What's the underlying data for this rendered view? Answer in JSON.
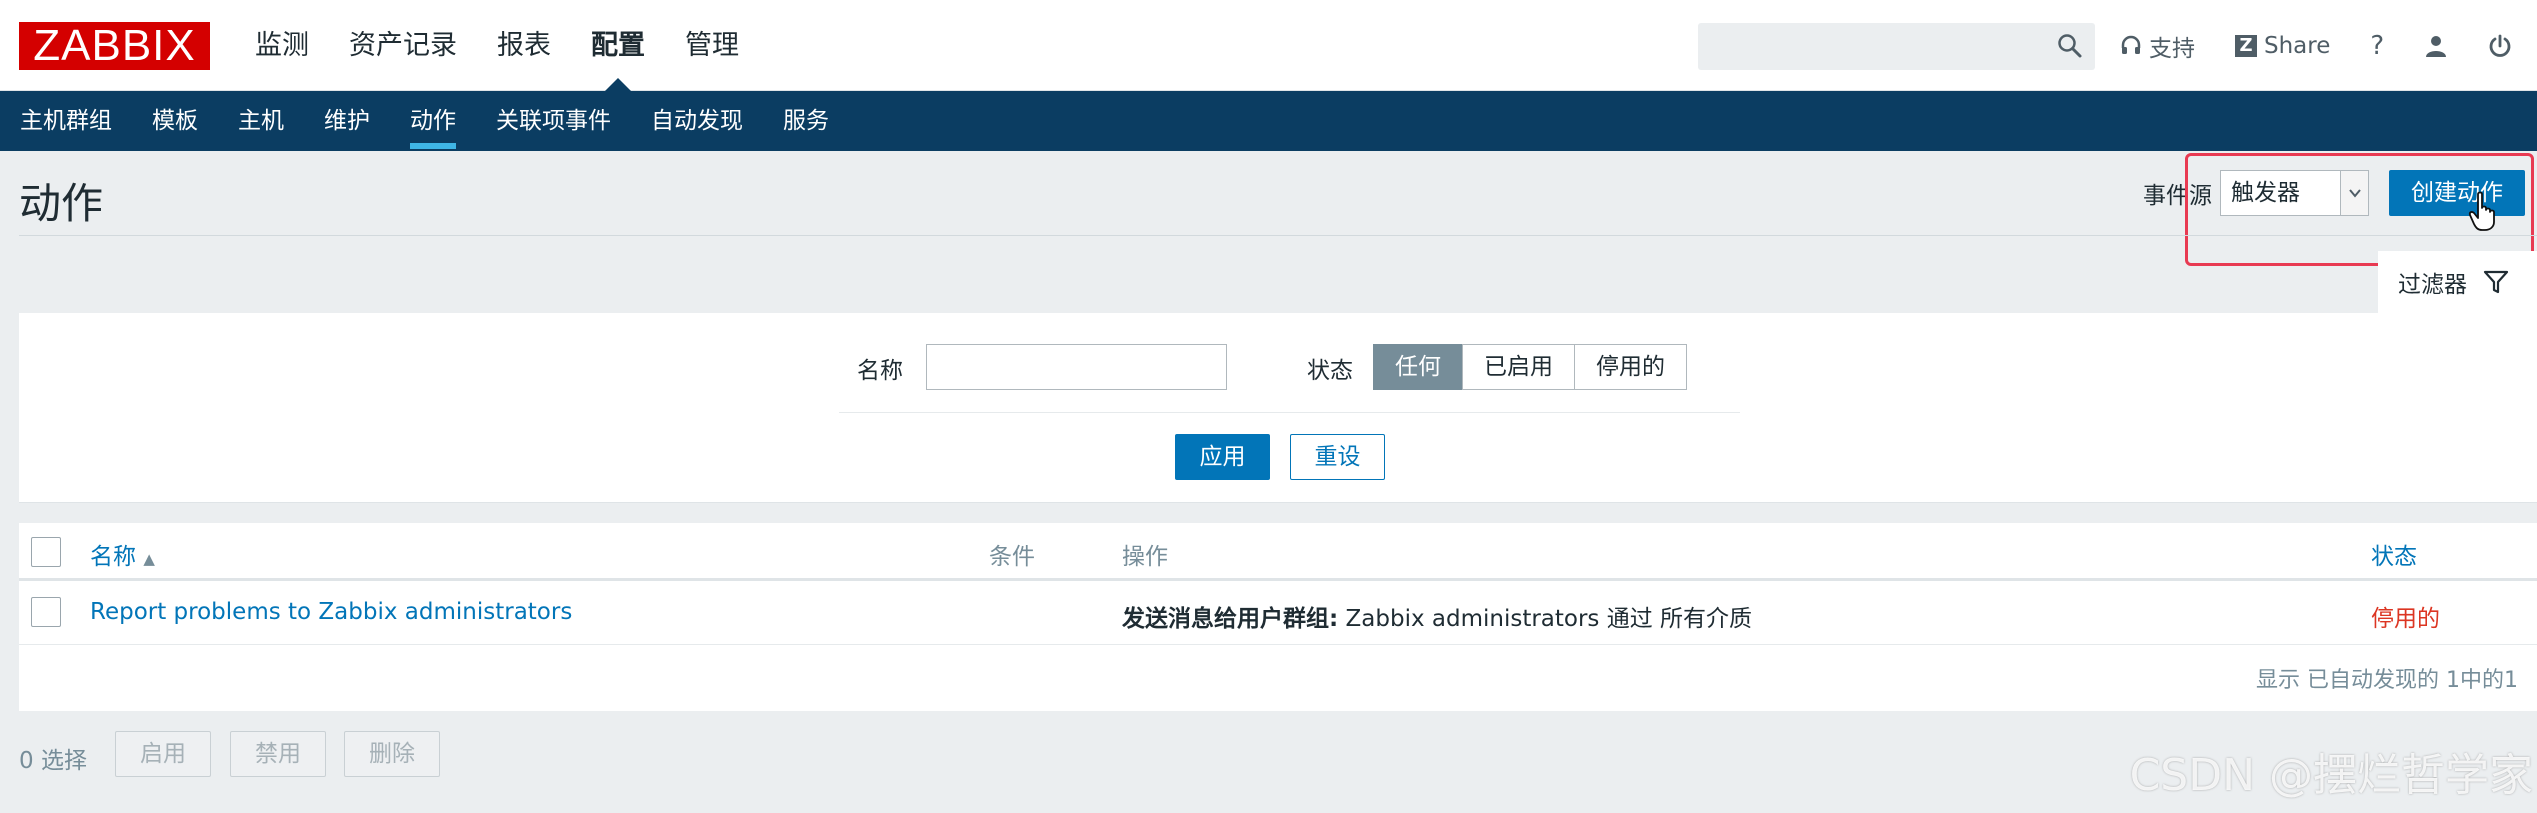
{
  "brand": {
    "logo_text": "ZABBIX",
    "logo_color": "#d40000"
  },
  "main_menu": [
    {
      "label": "监测",
      "active": false
    },
    {
      "label": "资产记录",
      "active": false
    },
    {
      "label": "报表",
      "active": false
    },
    {
      "label": "配置",
      "active": true
    },
    {
      "label": "管理",
      "active": false
    }
  ],
  "search": {
    "placeholder": "",
    "value": ""
  },
  "top_links": {
    "support": "支持",
    "share": "Share",
    "help": "?"
  },
  "sub_menu": [
    {
      "label": "主机群组",
      "active": false
    },
    {
      "label": "模板",
      "active": false
    },
    {
      "label": "主机",
      "active": false
    },
    {
      "label": "维护",
      "active": false
    },
    {
      "label": "动作",
      "active": true
    },
    {
      "label": "关联项事件",
      "active": false
    },
    {
      "label": "自动发现",
      "active": false
    },
    {
      "label": "服务",
      "active": false
    }
  ],
  "page": {
    "title": "动作",
    "event_source_label": "事件源",
    "event_source_value": "触发器",
    "create_button": "创建动作"
  },
  "filter": {
    "tab_label": "过滤器",
    "name_label": "名称",
    "name_value": "",
    "state_label": "状态",
    "state_options": [
      "任何",
      "已启用",
      "停用的"
    ],
    "state_selected": "任何",
    "apply": "应用",
    "reset": "重设"
  },
  "table": {
    "columns": {
      "name": "名称",
      "sort_indicator": "▲",
      "conditions": "条件",
      "operations": "操作",
      "status": "状态"
    },
    "rows": [
      {
        "name": "Report problems to Zabbix administrators",
        "conditions": "",
        "operation_bold": "发送消息给用户群组:",
        "operation_text": " Zabbix administrators 通过 所有介质",
        "status": "停用的"
      }
    ],
    "footer": "显示 已自动发现的 1中的1"
  },
  "bulk_actions": {
    "selected": "0 选择",
    "enable": "启用",
    "disable": "禁用",
    "delete": "删除"
  },
  "watermark": "CSDN @摆烂哲学家",
  "colors": {
    "nav_bg": "#0b3d62",
    "primary": "#0275b8",
    "disabled_status": "#dc3522",
    "highlight": "#e83a52"
  }
}
